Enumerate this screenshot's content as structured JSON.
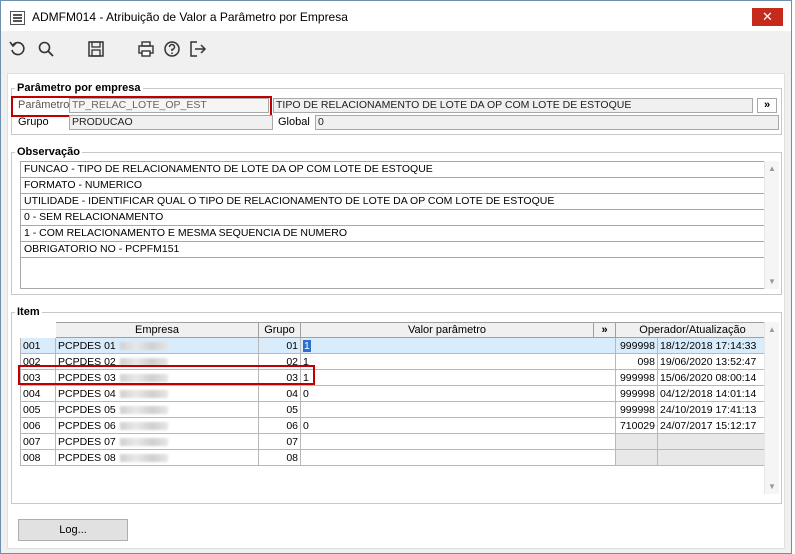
{
  "window": {
    "title": "ADMFM014 - Atribuição de Valor a Parâmetro por Empresa",
    "close_glyph": "✕"
  },
  "toolbar": {
    "icons": [
      "undo-icon",
      "search-icon",
      "save-icon",
      "print-icon",
      "help-icon",
      "exit-icon"
    ]
  },
  "parametro": {
    "legend": "Parâmetro por empresa",
    "parametro_label": "Parâmetro",
    "parametro_value": "TP_RELAC_LOTE_OP_EST",
    "descricao": "TIPO DE RELACIONAMENTO DE LOTE DA OP COM LOTE DE ESTOQUE",
    "expand_glyph": "»",
    "grupo_label": "Grupo",
    "grupo_value": "PRODUCAO",
    "global_label": "Global",
    "global_value": "0"
  },
  "observacao": {
    "legend": "Observação",
    "lines": [
      "FUNCAO - TIPO DE RELACIONAMENTO DE LOTE DA OP COM LOTE DE ESTOQUE",
      "FORMATO - NUMERICO",
      "UTILIDADE - IDENTIFICAR QUAL O TIPO DE RELACIONAMENTO DE LOTE DA OP COM LOTE DE ESTOQUE",
      "0 - SEM RELACIONAMENTO",
      "1 - COM RELACIONAMENTO E MESMA SEQUENCIA DE NUMERO",
      "OBRIGATORIO NO - PCPFM151"
    ]
  },
  "item": {
    "legend": "Item",
    "columns": {
      "empresa": "Empresa",
      "grupo": "Grupo",
      "valor": "Valor parâmetro",
      "expand": "»",
      "operador": "Operador/Atualização"
    },
    "rows": [
      {
        "cod": "001",
        "empresa": "PCPDES 01",
        "grupo": "01",
        "valor": "1",
        "operador": "999998",
        "data": "18/12/2018 17:14:33"
      },
      {
        "cod": "002",
        "empresa": "PCPDES 02",
        "grupo": "02",
        "valor": "1",
        "operador": "098",
        "data": "19/06/2020 13:52:47"
      },
      {
        "cod": "003",
        "empresa": "PCPDES 03",
        "grupo": "03",
        "valor": "1",
        "operador": "999998",
        "data": "15/06/2020 08:00:14"
      },
      {
        "cod": "004",
        "empresa": "PCPDES 04",
        "grupo": "04",
        "valor": "0",
        "operador": "999998",
        "data": "04/12/2018 14:01:14"
      },
      {
        "cod": "005",
        "empresa": "PCPDES 05",
        "grupo": "05",
        "valor": "",
        "operador": "999998",
        "data": "24/10/2019 17:41:13"
      },
      {
        "cod": "006",
        "empresa": "PCPDES 06",
        "grupo": "06",
        "valor": "0",
        "operador": "710029",
        "data": "24/07/2017 15:12:17"
      },
      {
        "cod": "007",
        "empresa": "PCPDES 07",
        "grupo": "07",
        "valor": "",
        "operador": "",
        "data": ""
      },
      {
        "cod": "008",
        "empresa": "PCPDES 08",
        "grupo": "08",
        "valor": "",
        "operador": "",
        "data": ""
      }
    ]
  },
  "footer": {
    "log_label": "Log..."
  }
}
